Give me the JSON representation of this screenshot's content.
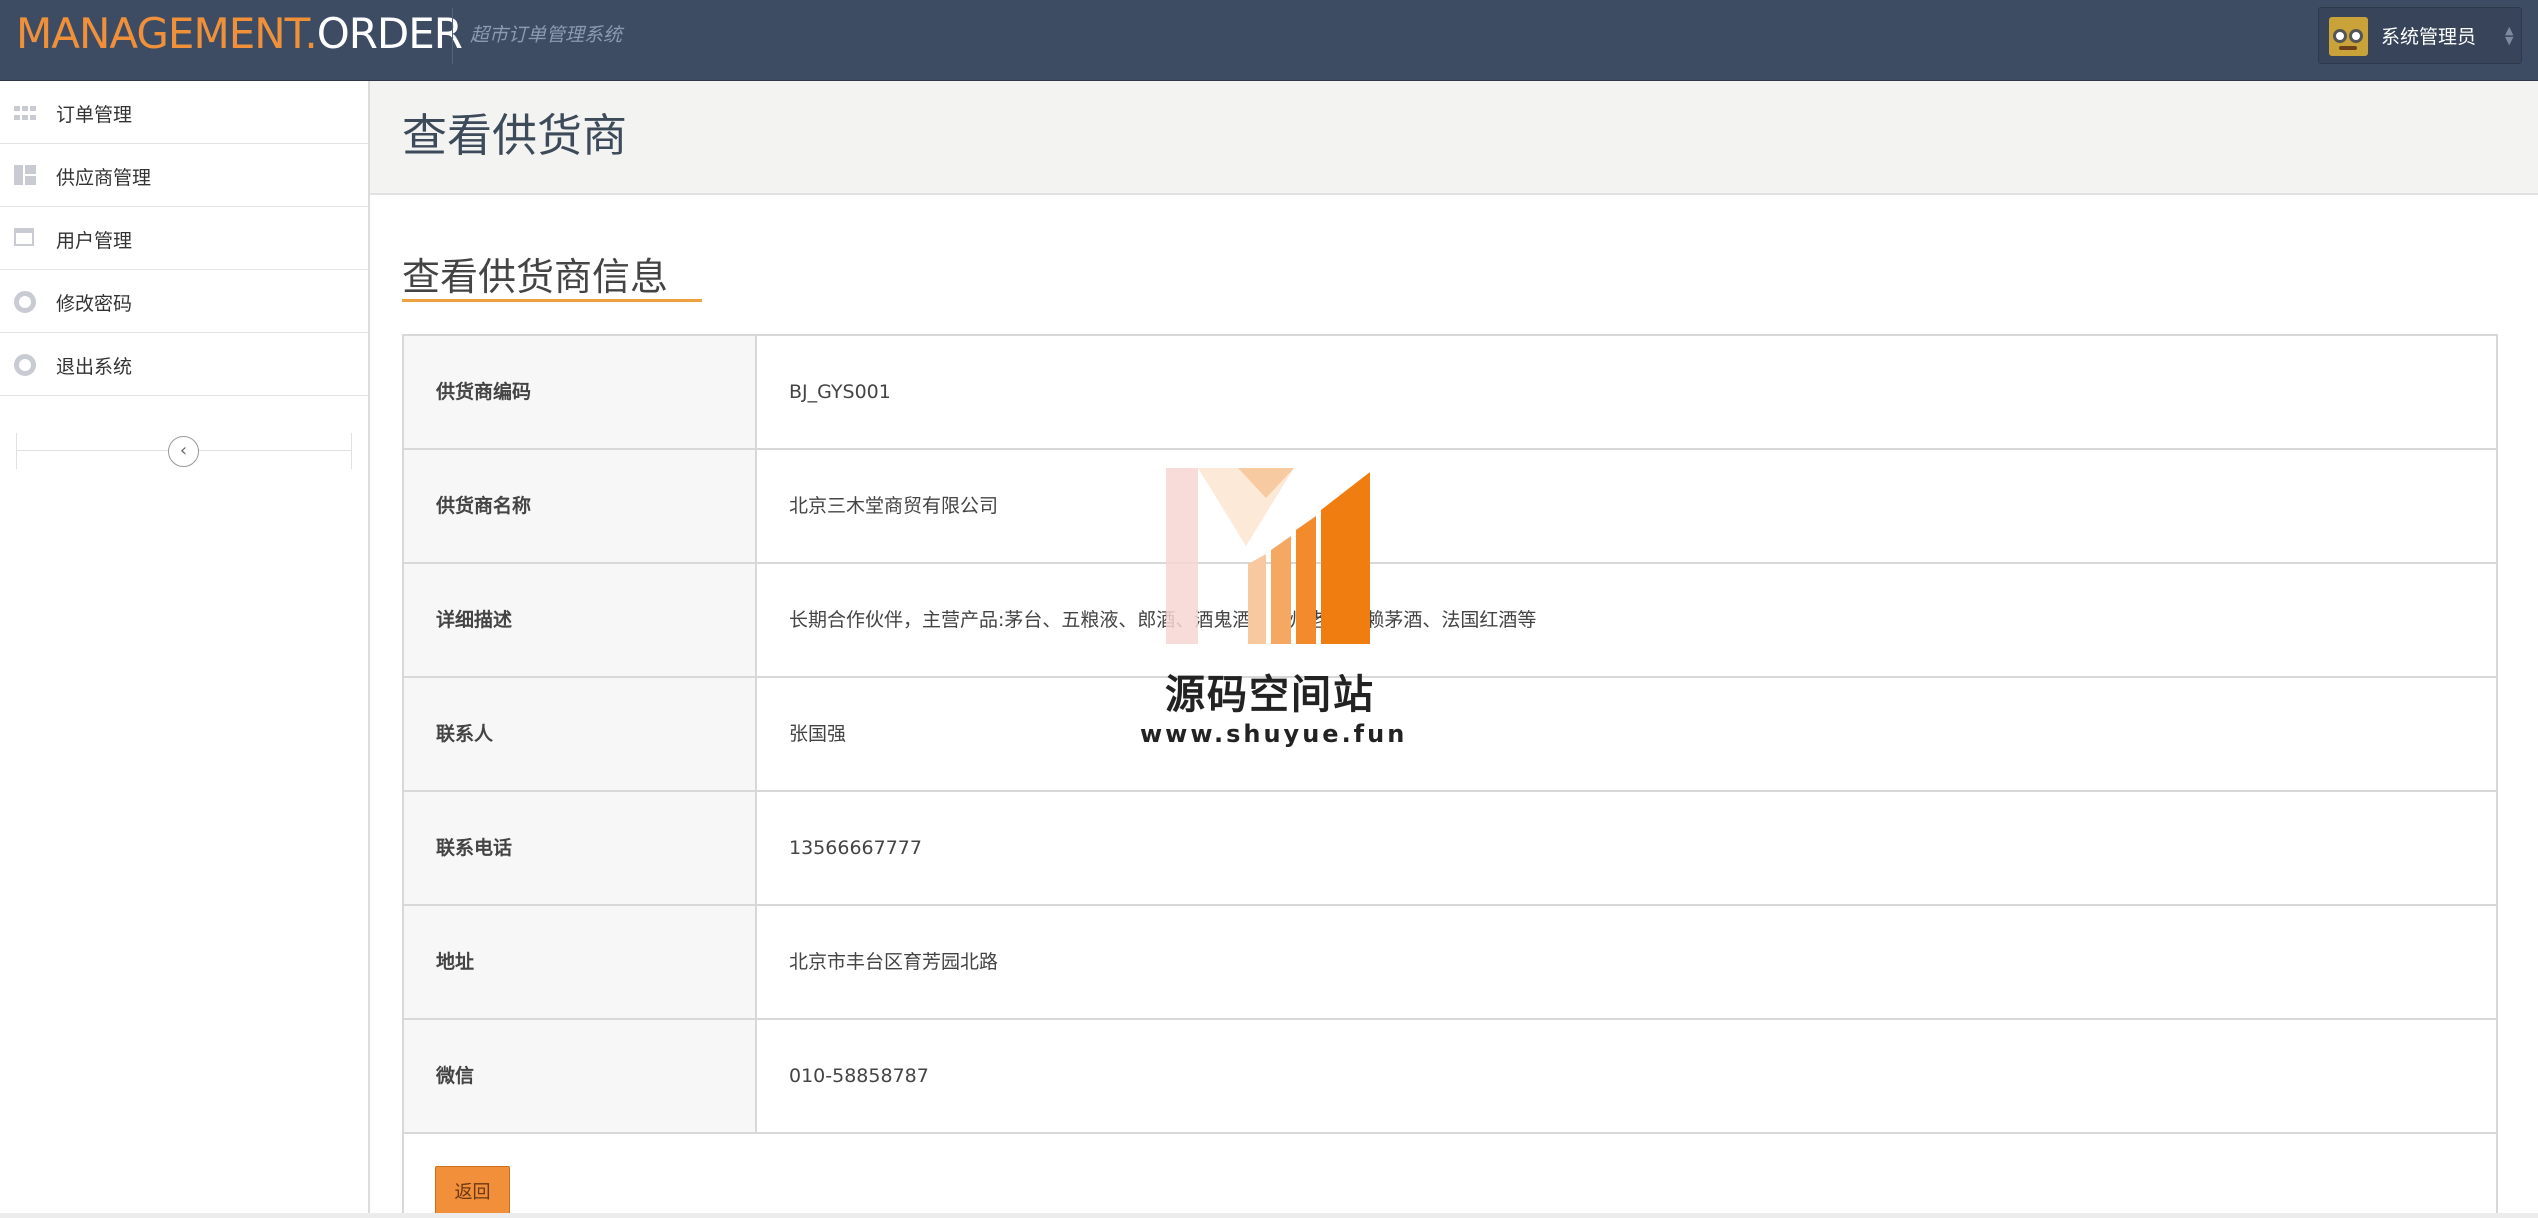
{
  "header": {
    "logo_part1": "MANAGEMENT.",
    "logo_part2": "ORDER",
    "subtitle": "超市订单管理系统",
    "user_name": "系统管理员",
    "brand_orange": "#f0913a",
    "bar_color": "#3d4c63"
  },
  "sidebar": {
    "items": [
      {
        "label": "订单管理",
        "icon": "grid-icon"
      },
      {
        "label": "供应商管理",
        "icon": "layout-icon"
      },
      {
        "label": "用户管理",
        "icon": "calendar-icon"
      },
      {
        "label": "修改密码",
        "icon": "lifebuoy-icon"
      },
      {
        "label": "退出系统",
        "icon": "lifebuoy-icon"
      }
    ],
    "collapse_icon": "chevron-left-icon"
  },
  "main": {
    "page_title": "查看供货商",
    "section_title": "查看供货商信息",
    "fields": [
      {
        "label": "供货商编码",
        "value": "BJ_GYS001"
      },
      {
        "label": "供货商名称",
        "value": "北京三木堂商贸有限公司"
      },
      {
        "label": "详细描述",
        "value": "长期合作伙伴，主营产品:茅台、五粮液、郎酒、酒鬼酒、泸州老窖、赖茅酒、法国红酒等"
      },
      {
        "label": "联系人",
        "value": "张国强"
      },
      {
        "label": "联系电话",
        "value": "13566667777"
      },
      {
        "label": "地址",
        "value": "北京市丰台区育芳园北路"
      },
      {
        "label": "微信",
        "value": "010-58858787"
      }
    ],
    "back_label": "返回",
    "back_color": "#f28f3b"
  },
  "watermark": {
    "title": "源码空间站",
    "url": "www.shuyue.fun"
  }
}
